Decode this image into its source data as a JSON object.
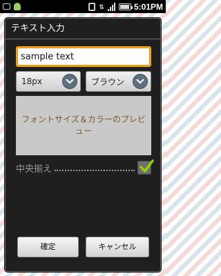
{
  "status_bar": {
    "time": "5:01PM",
    "icons": [
      "usb-icon",
      "android-icon",
      "vibrate-icon",
      "data-icon",
      "signal-icon",
      "battery-icon"
    ]
  },
  "dialog": {
    "title": "テキスト入力",
    "text_input": {
      "value": "sample text"
    },
    "font_size": {
      "selected": "18px"
    },
    "color": {
      "selected": "ブラウン"
    },
    "preview": {
      "text": "フォントサイズ＆カラーのプレビュー",
      "color": "#7a5a2e"
    },
    "center_align": {
      "label": "中央揃え",
      "checked": true
    },
    "buttons": {
      "ok": "確定",
      "cancel": "キャンセル"
    }
  },
  "colors": {
    "accent": "#f3a712",
    "check": "#8fd400"
  }
}
